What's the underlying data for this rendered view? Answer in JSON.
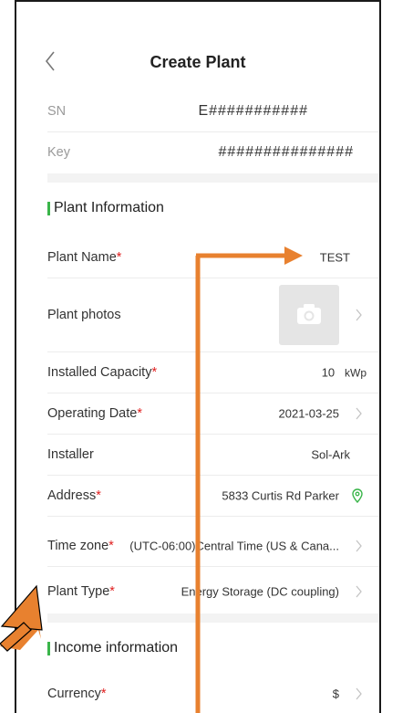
{
  "header": {
    "title": "Create Plant"
  },
  "device": {
    "sn_label": "SN",
    "sn_value": "E###########",
    "key_label": "Key",
    "key_value": "###############"
  },
  "plant_info": {
    "section_title": "Plant Information",
    "plant_name_label": "Plant Name",
    "plant_name_value": "TEST",
    "photos_label": "Plant photos",
    "capacity_label": "Installed Capacity",
    "capacity_value": "10",
    "capacity_unit": "kWp",
    "operating_date_label": "Operating Date",
    "operating_date_value": "2021-03-25",
    "installer_label": "Installer",
    "installer_value": "Sol-Ark",
    "address_label": "Address",
    "address_value": "5833 Curtis Rd Parker",
    "timezone_label": "Time zone",
    "timezone_value": "(UTC-06:00)Central Time (US & Cana...",
    "plant_type_label": "Plant Type",
    "plant_type_value": "Energy Storage (DC coupling)"
  },
  "income_info": {
    "section_title": "Income information",
    "currency_label": "Currency",
    "currency_value": "$"
  },
  "required_mark": "*",
  "colors": {
    "accent": "#3ab54a",
    "required": "#e02020",
    "annotation_arrow": "#e8812f"
  },
  "icons": [
    "chevron-left-icon",
    "camera-icon",
    "chevron-right-icon",
    "location-pin-icon"
  ]
}
